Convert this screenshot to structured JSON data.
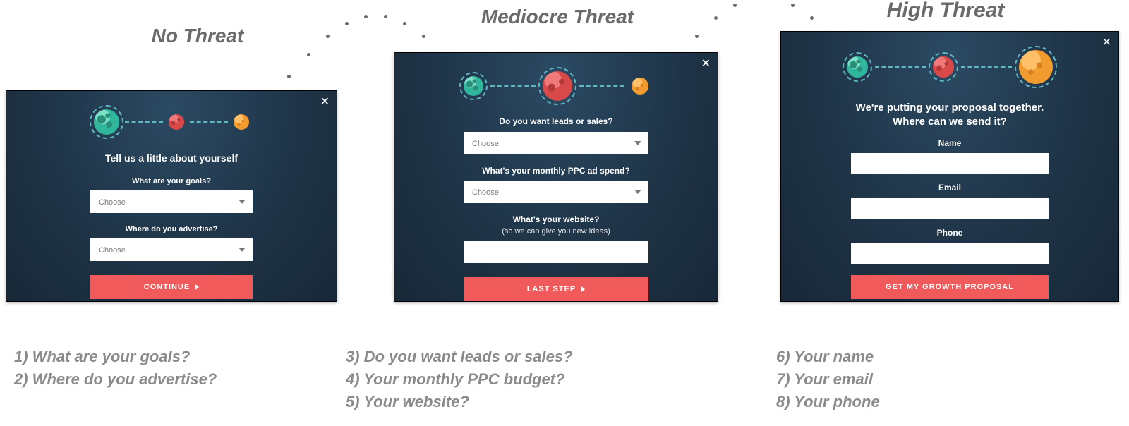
{
  "labels": {
    "stage1": "No Threat",
    "stage2": "Mediocre Threat",
    "stage3": "High Threat"
  },
  "stage1": {
    "headline": "Tell us a little about yourself",
    "q1": "What are your goals?",
    "q2": "Where do you advertise?",
    "choose": "Choose",
    "cta": "CONTINUE"
  },
  "stage2": {
    "q1": "Do you want leads or sales?",
    "q2": "What's your monthly PPC ad spend?",
    "q3a": "What's your website?",
    "q3b": "(so we can give you new ideas)",
    "choose": "Choose",
    "cta": "LAST STEP"
  },
  "stage3": {
    "headline1": "We're putting your proposal together.",
    "headline2": "Where can we send it?",
    "f1": "Name",
    "f2": "Email",
    "f3": "Phone",
    "cta": "GET MY GROWTH PROPOSAL"
  },
  "captions": {
    "c1": "1) What are your goals?",
    "c2": "2) Where do you advertise?",
    "c3": "3) Do you want leads or sales?",
    "c4": "4) Your monthly PPC budget?",
    "c5": "5) Your website?",
    "c6": "6) Your name",
    "c7": "7) Your email",
    "c8": "8) Your phone"
  },
  "colors": {
    "accent": "#f05a5a",
    "modal_bg": "#1f3447",
    "planet_ring": "#5fb6c4"
  }
}
